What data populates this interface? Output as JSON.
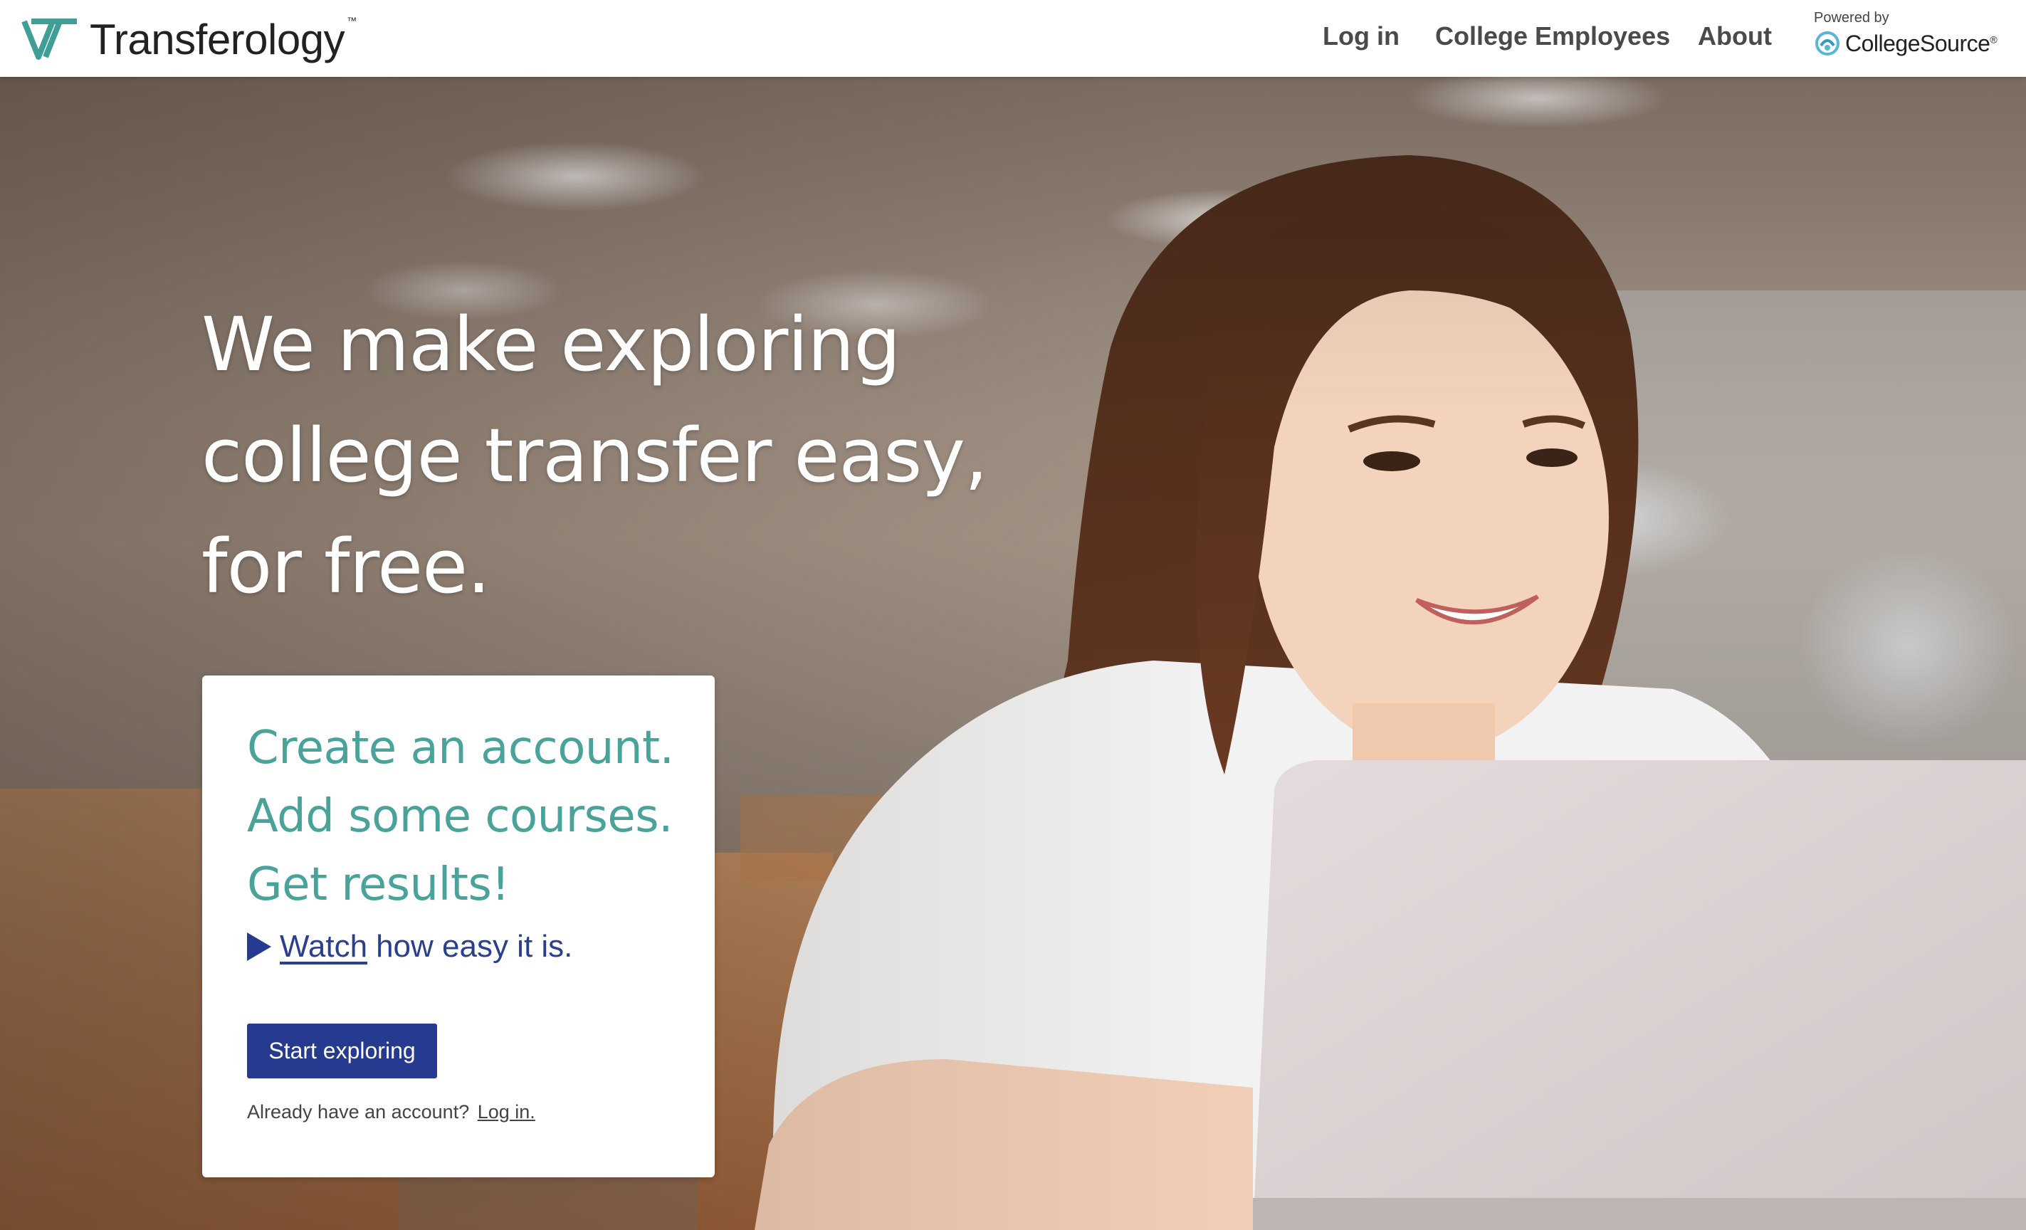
{
  "header": {
    "brand_name": "Transferology",
    "brand_tm": "™",
    "nav": {
      "login": "Log in",
      "college_employees": "College Employees",
      "about": "About"
    },
    "powered_by": "Powered by",
    "partner_name": "CollegeSource",
    "partner_reg": "®"
  },
  "hero": {
    "headline": [
      "We make exploring",
      "college transfer easy,",
      "for free."
    ]
  },
  "card": {
    "lines": [
      "Create an account.",
      "Add some courses.",
      "Get results!"
    ],
    "watch_link": "Watch",
    "watch_rest": "how easy it is.",
    "start_button": "Start exploring",
    "account_prompt": "Already have an account?",
    "account_link": "Log in."
  },
  "colors": {
    "brand_teal": "#4aa39b",
    "primary_blue": "#263b8f",
    "link_blue": "#2a3f8f",
    "nav_text": "#4a4a4a"
  },
  "icons": {
    "brand": "transferology-logo-icon",
    "partner": "collegesource-logo-icon",
    "play": "play-icon"
  }
}
